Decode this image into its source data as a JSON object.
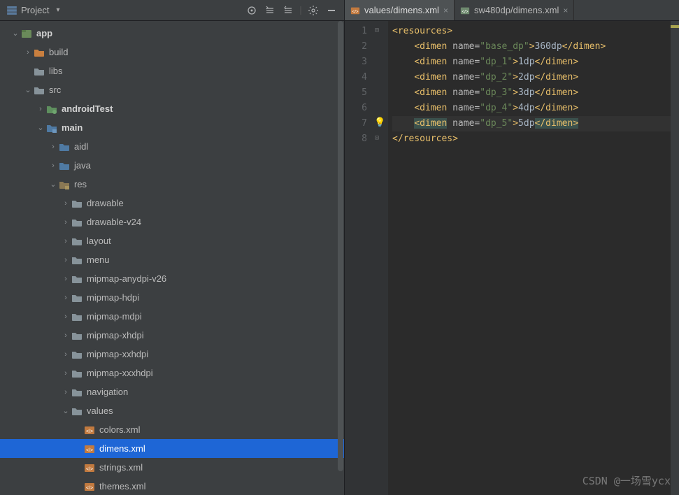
{
  "project_panel": {
    "title": "Project",
    "actions": [
      "target",
      "expand-all",
      "collapse-all",
      "divider",
      "settings",
      "minimize"
    ]
  },
  "tree": [
    {
      "depth": 0,
      "arrow": "down",
      "icon": "module",
      "label": "app",
      "bold": true
    },
    {
      "depth": 1,
      "arrow": "right",
      "icon": "folder-orange",
      "label": "build"
    },
    {
      "depth": 1,
      "arrow": "none",
      "icon": "folder",
      "label": "libs"
    },
    {
      "depth": 1,
      "arrow": "down",
      "icon": "folder",
      "label": "src"
    },
    {
      "depth": 2,
      "arrow": "right",
      "icon": "folder-test",
      "label": "androidTest",
      "bold": true
    },
    {
      "depth": 2,
      "arrow": "down",
      "icon": "folder-src",
      "label": "main",
      "bold": true
    },
    {
      "depth": 3,
      "arrow": "right",
      "icon": "folder-pkg",
      "label": "aidl"
    },
    {
      "depth": 3,
      "arrow": "right",
      "icon": "folder-pkg",
      "label": "java"
    },
    {
      "depth": 3,
      "arrow": "down",
      "icon": "folder-res",
      "label": "res"
    },
    {
      "depth": 4,
      "arrow": "right",
      "icon": "folder",
      "label": "drawable"
    },
    {
      "depth": 4,
      "arrow": "right",
      "icon": "folder",
      "label": "drawable-v24"
    },
    {
      "depth": 4,
      "arrow": "right",
      "icon": "folder",
      "label": "layout"
    },
    {
      "depth": 4,
      "arrow": "right",
      "icon": "folder",
      "label": "menu"
    },
    {
      "depth": 4,
      "arrow": "right",
      "icon": "folder",
      "label": "mipmap-anydpi-v26"
    },
    {
      "depth": 4,
      "arrow": "right",
      "icon": "folder",
      "label": "mipmap-hdpi"
    },
    {
      "depth": 4,
      "arrow": "right",
      "icon": "folder",
      "label": "mipmap-mdpi"
    },
    {
      "depth": 4,
      "arrow": "right",
      "icon": "folder",
      "label": "mipmap-xhdpi"
    },
    {
      "depth": 4,
      "arrow": "right",
      "icon": "folder",
      "label": "mipmap-xxhdpi"
    },
    {
      "depth": 4,
      "arrow": "right",
      "icon": "folder",
      "label": "mipmap-xxxhdpi"
    },
    {
      "depth": 4,
      "arrow": "right",
      "icon": "folder",
      "label": "navigation"
    },
    {
      "depth": 4,
      "arrow": "down",
      "icon": "folder",
      "label": "values"
    },
    {
      "depth": 5,
      "arrow": "none",
      "icon": "xml",
      "label": "colors.xml"
    },
    {
      "depth": 5,
      "arrow": "none",
      "icon": "xml",
      "label": "dimens.xml",
      "selected": true
    },
    {
      "depth": 5,
      "arrow": "none",
      "icon": "xml",
      "label": "strings.xml"
    },
    {
      "depth": 5,
      "arrow": "none",
      "icon": "xml",
      "label": "themes.xml"
    }
  ],
  "tabs": [
    {
      "icon": "xml",
      "label": "values/dimens.xml",
      "active": true
    },
    {
      "icon": "xml-alt",
      "label": "sw480dp/dimens.xml",
      "active": false
    }
  ],
  "editor": {
    "current_line": 7,
    "lines": [
      {
        "n": 1,
        "fold": "open",
        "tokens": [
          [
            "tag",
            "<resources>"
          ]
        ]
      },
      {
        "n": 2,
        "tokens": [
          [
            "pad",
            "    "
          ],
          [
            "tag",
            "<dimen "
          ],
          [
            "attr",
            "name="
          ],
          [
            "val",
            "\"base_dp\""
          ],
          [
            "tag",
            ">"
          ],
          [
            "txt",
            "360dp"
          ],
          [
            "tag",
            "</dimen>"
          ]
        ]
      },
      {
        "n": 3,
        "tokens": [
          [
            "pad",
            "    "
          ],
          [
            "tag",
            "<dimen "
          ],
          [
            "attr",
            "name="
          ],
          [
            "val",
            "\"dp_1\""
          ],
          [
            "tag",
            ">"
          ],
          [
            "txt",
            "1dp"
          ],
          [
            "tag",
            "</dimen>"
          ]
        ]
      },
      {
        "n": 4,
        "tokens": [
          [
            "pad",
            "    "
          ],
          [
            "tag",
            "<dimen "
          ],
          [
            "attr",
            "name="
          ],
          [
            "val",
            "\"dp_2\""
          ],
          [
            "tag",
            ">"
          ],
          [
            "txt",
            "2dp"
          ],
          [
            "tag",
            "</dimen>"
          ]
        ]
      },
      {
        "n": 5,
        "tokens": [
          [
            "pad",
            "    "
          ],
          [
            "tag",
            "<dimen "
          ],
          [
            "attr",
            "name="
          ],
          [
            "val",
            "\"dp_3\""
          ],
          [
            "tag",
            ">"
          ],
          [
            "txt",
            "3dp"
          ],
          [
            "tag",
            "</dimen>"
          ]
        ]
      },
      {
        "n": 6,
        "tokens": [
          [
            "pad",
            "    "
          ],
          [
            "tag",
            "<dimen "
          ],
          [
            "attr",
            "name="
          ],
          [
            "val",
            "\"dp_4\""
          ],
          [
            "tag",
            ">"
          ],
          [
            "txt",
            "4dp"
          ],
          [
            "tag",
            "</dimen>"
          ]
        ]
      },
      {
        "n": 7,
        "bulb": true,
        "tokens": [
          [
            "pad",
            "    "
          ],
          [
            "tag-hl",
            "<dimen"
          ],
          [
            "tag",
            " "
          ],
          [
            "attr",
            "name="
          ],
          [
            "val",
            "\"dp_5\""
          ],
          [
            "tag",
            ">"
          ],
          [
            "txt",
            "5dp"
          ],
          [
            "tag-hl",
            "</dimen>"
          ]
        ]
      },
      {
        "n": 8,
        "fold": "close",
        "tokens": [
          [
            "tag",
            "</resources>"
          ]
        ]
      }
    ]
  },
  "watermark": "CSDN @一场雪ycx"
}
